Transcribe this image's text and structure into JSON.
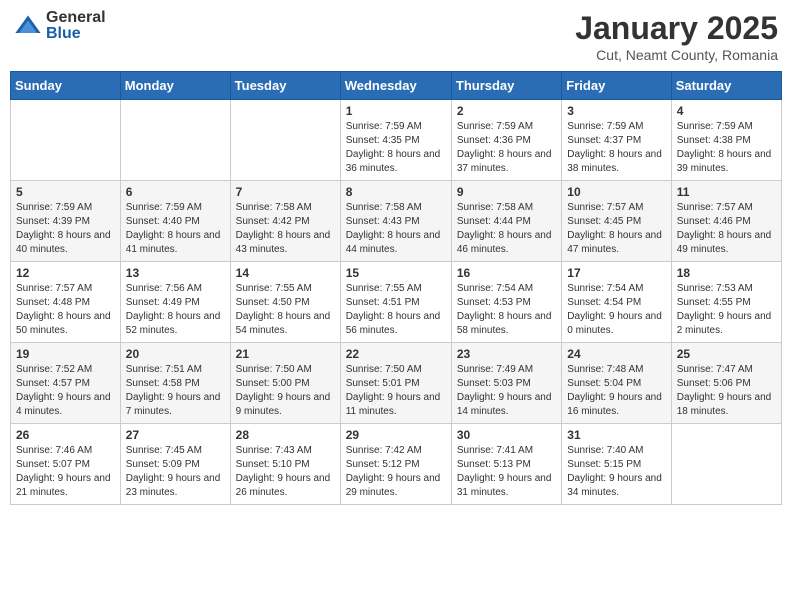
{
  "header": {
    "logo_general": "General",
    "logo_blue": "Blue",
    "month_title": "January 2025",
    "location": "Cut, Neamt County, Romania"
  },
  "weekdays": [
    "Sunday",
    "Monday",
    "Tuesday",
    "Wednesday",
    "Thursday",
    "Friday",
    "Saturday"
  ],
  "weeks": [
    [
      {
        "day": "",
        "info": ""
      },
      {
        "day": "",
        "info": ""
      },
      {
        "day": "",
        "info": ""
      },
      {
        "day": "1",
        "info": "Sunrise: 7:59 AM\nSunset: 4:35 PM\nDaylight: 8 hours and 36 minutes."
      },
      {
        "day": "2",
        "info": "Sunrise: 7:59 AM\nSunset: 4:36 PM\nDaylight: 8 hours and 37 minutes."
      },
      {
        "day": "3",
        "info": "Sunrise: 7:59 AM\nSunset: 4:37 PM\nDaylight: 8 hours and 38 minutes."
      },
      {
        "day": "4",
        "info": "Sunrise: 7:59 AM\nSunset: 4:38 PM\nDaylight: 8 hours and 39 minutes."
      }
    ],
    [
      {
        "day": "5",
        "info": "Sunrise: 7:59 AM\nSunset: 4:39 PM\nDaylight: 8 hours and 40 minutes."
      },
      {
        "day": "6",
        "info": "Sunrise: 7:59 AM\nSunset: 4:40 PM\nDaylight: 8 hours and 41 minutes."
      },
      {
        "day": "7",
        "info": "Sunrise: 7:58 AM\nSunset: 4:42 PM\nDaylight: 8 hours and 43 minutes."
      },
      {
        "day": "8",
        "info": "Sunrise: 7:58 AM\nSunset: 4:43 PM\nDaylight: 8 hours and 44 minutes."
      },
      {
        "day": "9",
        "info": "Sunrise: 7:58 AM\nSunset: 4:44 PM\nDaylight: 8 hours and 46 minutes."
      },
      {
        "day": "10",
        "info": "Sunrise: 7:57 AM\nSunset: 4:45 PM\nDaylight: 8 hours and 47 minutes."
      },
      {
        "day": "11",
        "info": "Sunrise: 7:57 AM\nSunset: 4:46 PM\nDaylight: 8 hours and 49 minutes."
      }
    ],
    [
      {
        "day": "12",
        "info": "Sunrise: 7:57 AM\nSunset: 4:48 PM\nDaylight: 8 hours and 50 minutes."
      },
      {
        "day": "13",
        "info": "Sunrise: 7:56 AM\nSunset: 4:49 PM\nDaylight: 8 hours and 52 minutes."
      },
      {
        "day": "14",
        "info": "Sunrise: 7:55 AM\nSunset: 4:50 PM\nDaylight: 8 hours and 54 minutes."
      },
      {
        "day": "15",
        "info": "Sunrise: 7:55 AM\nSunset: 4:51 PM\nDaylight: 8 hours and 56 minutes."
      },
      {
        "day": "16",
        "info": "Sunrise: 7:54 AM\nSunset: 4:53 PM\nDaylight: 8 hours and 58 minutes."
      },
      {
        "day": "17",
        "info": "Sunrise: 7:54 AM\nSunset: 4:54 PM\nDaylight: 9 hours and 0 minutes."
      },
      {
        "day": "18",
        "info": "Sunrise: 7:53 AM\nSunset: 4:55 PM\nDaylight: 9 hours and 2 minutes."
      }
    ],
    [
      {
        "day": "19",
        "info": "Sunrise: 7:52 AM\nSunset: 4:57 PM\nDaylight: 9 hours and 4 minutes."
      },
      {
        "day": "20",
        "info": "Sunrise: 7:51 AM\nSunset: 4:58 PM\nDaylight: 9 hours and 7 minutes."
      },
      {
        "day": "21",
        "info": "Sunrise: 7:50 AM\nSunset: 5:00 PM\nDaylight: 9 hours and 9 minutes."
      },
      {
        "day": "22",
        "info": "Sunrise: 7:50 AM\nSunset: 5:01 PM\nDaylight: 9 hours and 11 minutes."
      },
      {
        "day": "23",
        "info": "Sunrise: 7:49 AM\nSunset: 5:03 PM\nDaylight: 9 hours and 14 minutes."
      },
      {
        "day": "24",
        "info": "Sunrise: 7:48 AM\nSunset: 5:04 PM\nDaylight: 9 hours and 16 minutes."
      },
      {
        "day": "25",
        "info": "Sunrise: 7:47 AM\nSunset: 5:06 PM\nDaylight: 9 hours and 18 minutes."
      }
    ],
    [
      {
        "day": "26",
        "info": "Sunrise: 7:46 AM\nSunset: 5:07 PM\nDaylight: 9 hours and 21 minutes."
      },
      {
        "day": "27",
        "info": "Sunrise: 7:45 AM\nSunset: 5:09 PM\nDaylight: 9 hours and 23 minutes."
      },
      {
        "day": "28",
        "info": "Sunrise: 7:43 AM\nSunset: 5:10 PM\nDaylight: 9 hours and 26 minutes."
      },
      {
        "day": "29",
        "info": "Sunrise: 7:42 AM\nSunset: 5:12 PM\nDaylight: 9 hours and 29 minutes."
      },
      {
        "day": "30",
        "info": "Sunrise: 7:41 AM\nSunset: 5:13 PM\nDaylight: 9 hours and 31 minutes."
      },
      {
        "day": "31",
        "info": "Sunrise: 7:40 AM\nSunset: 5:15 PM\nDaylight: 9 hours and 34 minutes."
      },
      {
        "day": "",
        "info": ""
      }
    ]
  ]
}
